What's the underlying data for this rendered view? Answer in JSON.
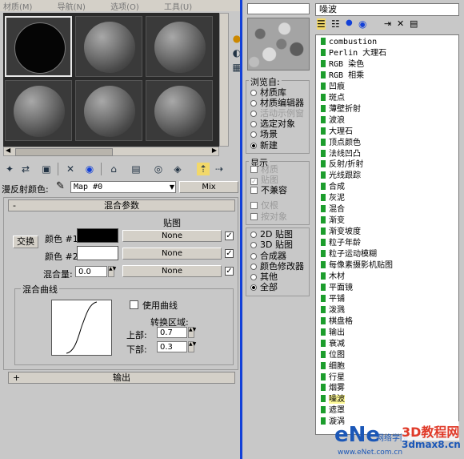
{
  "menu": [
    "材质(M)",
    "导航(N)",
    "选项(O)",
    "工具(U)"
  ],
  "toolbar": {
    "map_label": "漫反射颜色:",
    "map_name": "Map #0",
    "map_type": "Mix"
  },
  "mix_params": {
    "title": "混合参数",
    "map_header": "贴图",
    "swap": "交换",
    "color1_label": "颜色 #1",
    "color2_label": "颜色 #2",
    "amount_label": "混合量:",
    "amount_value": "0.0",
    "none1": "None",
    "none2": "None",
    "none3": "None",
    "color1": "#000000",
    "color2": "#ffffff"
  },
  "mix_curve": {
    "title": "混合曲线",
    "use_curve": "使用曲线",
    "transition_zone": "转换区域:",
    "upper_label": "上部:",
    "upper_value": "0.7",
    "lower_label": "下部:",
    "lower_value": "0.3"
  },
  "output_rollout": {
    "plus": "+",
    "title": "输出"
  },
  "browse": {
    "title": "浏览自:",
    "options": [
      {
        "label": "材质库",
        "selected": false,
        "disabled": false
      },
      {
        "label": "材质编辑器",
        "selected": false,
        "disabled": false
      },
      {
        "label": "活动示例窗",
        "selected": false,
        "disabled": true
      },
      {
        "label": "选定对象",
        "selected": false,
        "disabled": false
      },
      {
        "label": "场景",
        "selected": false,
        "disabled": false
      },
      {
        "label": "新建",
        "selected": true,
        "disabled": false
      }
    ]
  },
  "show": {
    "title": "显示",
    "options": [
      {
        "label": "材质",
        "checked": false,
        "disabled": true
      },
      {
        "label": "贴图",
        "checked": true,
        "disabled": true
      },
      {
        "label": "不兼容",
        "checked": false,
        "disabled": false
      }
    ],
    "options2": [
      {
        "label": "仅根",
        "disabled": true
      },
      {
        "label": "按对象",
        "disabled": true
      }
    ]
  },
  "map_filter": {
    "options": [
      {
        "label": "2D 贴图",
        "selected": false
      },
      {
        "label": "3D 贴图",
        "selected": false
      },
      {
        "label": "合成器",
        "selected": false
      },
      {
        "label": "颜色修改器",
        "selected": false
      },
      {
        "label": "其他",
        "selected": false
      },
      {
        "label": "全部",
        "selected": true
      }
    ]
  },
  "browser": {
    "search_value": "",
    "selected_title": "噪波",
    "items": [
      "combustion",
      "Perlin 大理石",
      "RGB 染色",
      "RGB 相乘",
      "凹痕",
      "斑点",
      "薄壁折射",
      "波浪",
      "大理石",
      "顶点颜色",
      "法线凹凸",
      "反射/折射",
      "光线跟踪",
      "合成",
      "灰泥",
      "混合",
      "渐变",
      "渐变坡度",
      "粒子年龄",
      "粒子运动模糊",
      "每像素摄影机贴图",
      "木材",
      "平面镜",
      "平铺",
      "泼溅",
      "棋盘格",
      "输出",
      "衰减",
      "位图",
      "细胞",
      "行星",
      "烟雾",
      "噪波",
      "遮罩",
      "漩涡"
    ],
    "selected_index": 32
  },
  "watermark": {
    "brand": "3D教程网",
    "site": "3dmax8.cn",
    "prefix": "eNe",
    "sub": "网络学院",
    "url": "www.eNet.com.cn"
  },
  "colors": {
    "accent_divider": "#1240d8",
    "list_icon": "#1c9d2c",
    "selection": "#fffa98"
  }
}
